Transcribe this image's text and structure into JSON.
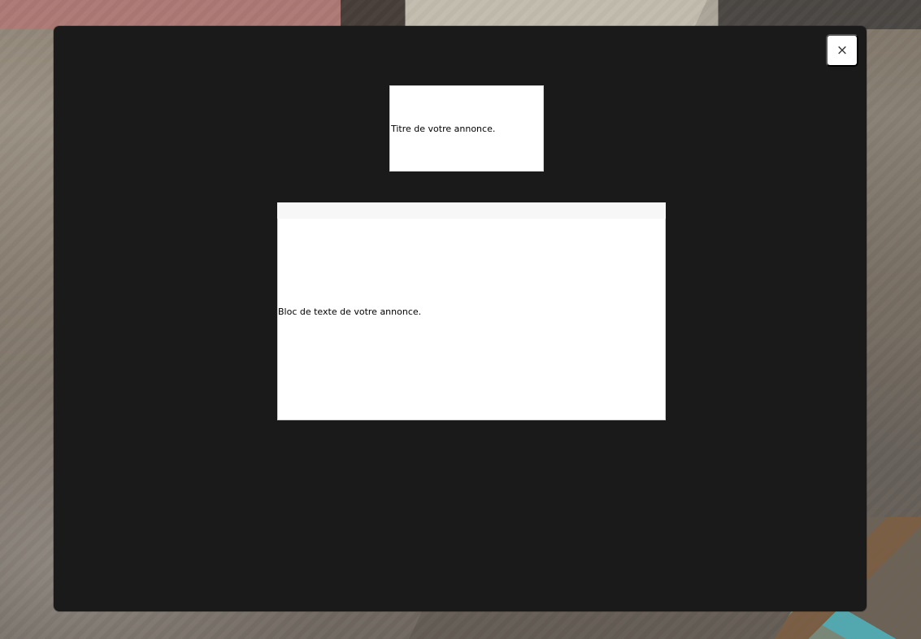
{
  "dialog": {
    "close_label": "×",
    "title_placeholder": "Titre de votre annonce.",
    "body_placeholder": "Bloc de texte de votre annonce."
  },
  "icons": {
    "close": "close-icon"
  },
  "colors": {
    "dialog_background": "#1a1a1a",
    "field_background": "#ffffff",
    "close_button_background": "#ffffff"
  }
}
